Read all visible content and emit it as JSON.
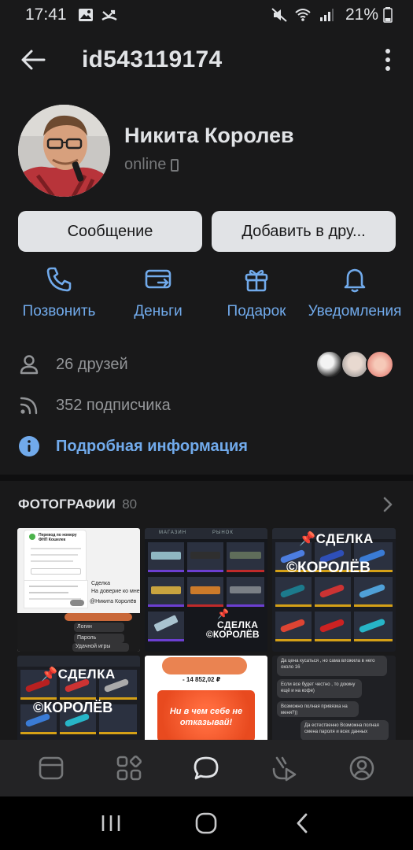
{
  "status_bar": {
    "time": "17:41",
    "battery": "21%"
  },
  "header": {
    "title": "id543119174"
  },
  "profile": {
    "name": "Никита Королев",
    "status": "online"
  },
  "buttons": {
    "message": "Сообщение",
    "add_friend": "Добавить в дру..."
  },
  "actions": [
    {
      "label": "Позвонить",
      "icon": "phone-icon"
    },
    {
      "label": "Деньги",
      "icon": "money-transfer-icon"
    },
    {
      "label": "Подарок",
      "icon": "gift-icon"
    },
    {
      "label": "Уведомления",
      "icon": "bell-icon"
    }
  ],
  "info": {
    "friends": "26 друзей",
    "followers": "352 подписчика",
    "details": "Подробная информация"
  },
  "photos": {
    "label": "ФОТОГРАФИИ",
    "count": "80",
    "tiles": {
      "t1_title": "Перевод по номеру ФНП Кошелек",
      "t1_caption1": "Сделка",
      "t1_caption2": "На доверие ко мне",
      "t1_caption3": "@Никита Королёв",
      "t1_login": "Логин",
      "t1_password": "Пароль",
      "t1_luck": "Удачной игры",
      "t2_tab1": "МАГАЗИН",
      "t2_tab2": "РЫНОК",
      "t2_deal": "СДЕЛКА",
      "t2_sign": "©КОРОЛЁВ",
      "t3_deal": "СДЕЛКА",
      "t3_sign": "©КОРОЛЁВ",
      "t4_deal": "СДЕЛКА",
      "t4_sign": "©КОРОЛЁВ",
      "t5_amount": "- 14 852,02 ₽",
      "t5_banner": "Ни в чем себе не отказывай!",
      "t6_msg1": "Да цена кусаться , но сама вложила в него около 16",
      "t6_msg2": "Если все будет честно , то докину ещё и на кофе)",
      "t6_msg3": "Возможно полная привязка на меня?))",
      "t6_msg4": "Да естественно Возможна полная смена пароля и всех данных"
    }
  },
  "colors": {
    "background": "#19191a",
    "accent": "#71aaeb",
    "button_bg": "#e1e3e6",
    "secondary_text": "#939598"
  }
}
